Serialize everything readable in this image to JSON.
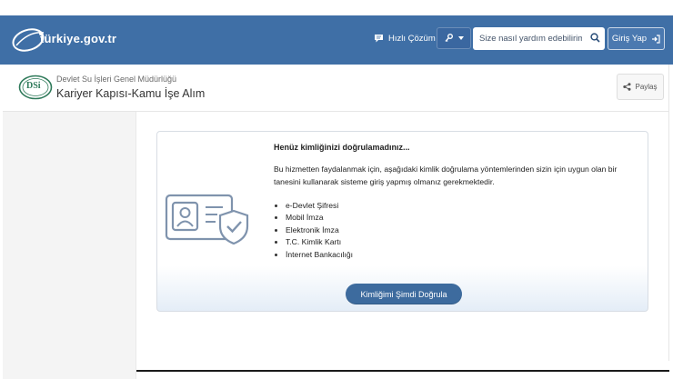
{
  "header": {
    "logo_text": "türkiye.gov.tr",
    "quick_solution_label": "Hızlı Çözüm",
    "search_placeholder": "Size nasıl yardım edebilirim?",
    "login_label": "Giriş Yap",
    "colors": {
      "header_bg": "#3f6fa6",
      "primary_button": "#3d6b9e"
    }
  },
  "institution": {
    "logo_text": "DSi",
    "org_name": "Devlet Su İşleri Genel Müdürlüğü",
    "service_title": "Kariyer Kapısı-Kamu İşe Alım",
    "share_label": "Paylaş"
  },
  "auth_card": {
    "title": "Henüz kimliğinizi doğrulamadınız...",
    "description": "Bu hizmetten faydalanmak için, aşağıdaki kimlik doğrulama yöntemlerinden sizin için uygun olan bir tanesini kullanarak sisteme giriş yapmış olmanız gerekmektedir.",
    "methods": [
      "e-Devlet Şifresi",
      "Mobil İmza",
      "Elektronik İmza",
      "T.C. Kimlik Kartı",
      "İnternet Bankacılığı"
    ],
    "verify_button_label": "Kimliğimi Şimdi Doğrula",
    "illustration_icon": "id-card-shield-icon"
  }
}
